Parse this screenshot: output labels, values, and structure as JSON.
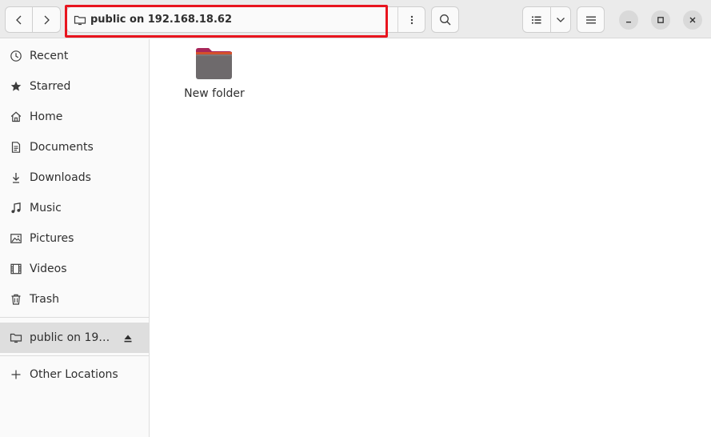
{
  "header": {
    "location_label": "public on 192.168.18.62"
  },
  "sidebar": {
    "items": [
      {
        "label": "Recent",
        "icon": "clock-icon"
      },
      {
        "label": "Starred",
        "icon": "star-icon"
      },
      {
        "label": "Home",
        "icon": "home-icon"
      },
      {
        "label": "Documents",
        "icon": "document-icon"
      },
      {
        "label": "Downloads",
        "icon": "download-icon"
      },
      {
        "label": "Music",
        "icon": "music-icon"
      },
      {
        "label": "Pictures",
        "icon": "picture-icon"
      },
      {
        "label": "Videos",
        "icon": "video-icon"
      },
      {
        "label": "Trash",
        "icon": "trash-icon"
      }
    ],
    "network_mount": {
      "label": "public on 19…",
      "icon": "network-folder-icon",
      "selected": true
    },
    "other_locations": {
      "label": "Other Locations",
      "icon": "plus-icon"
    }
  },
  "main": {
    "files": [
      {
        "name": "New folder",
        "type": "folder"
      }
    ]
  },
  "annotation": {
    "highlight_color": "#e8141e"
  }
}
